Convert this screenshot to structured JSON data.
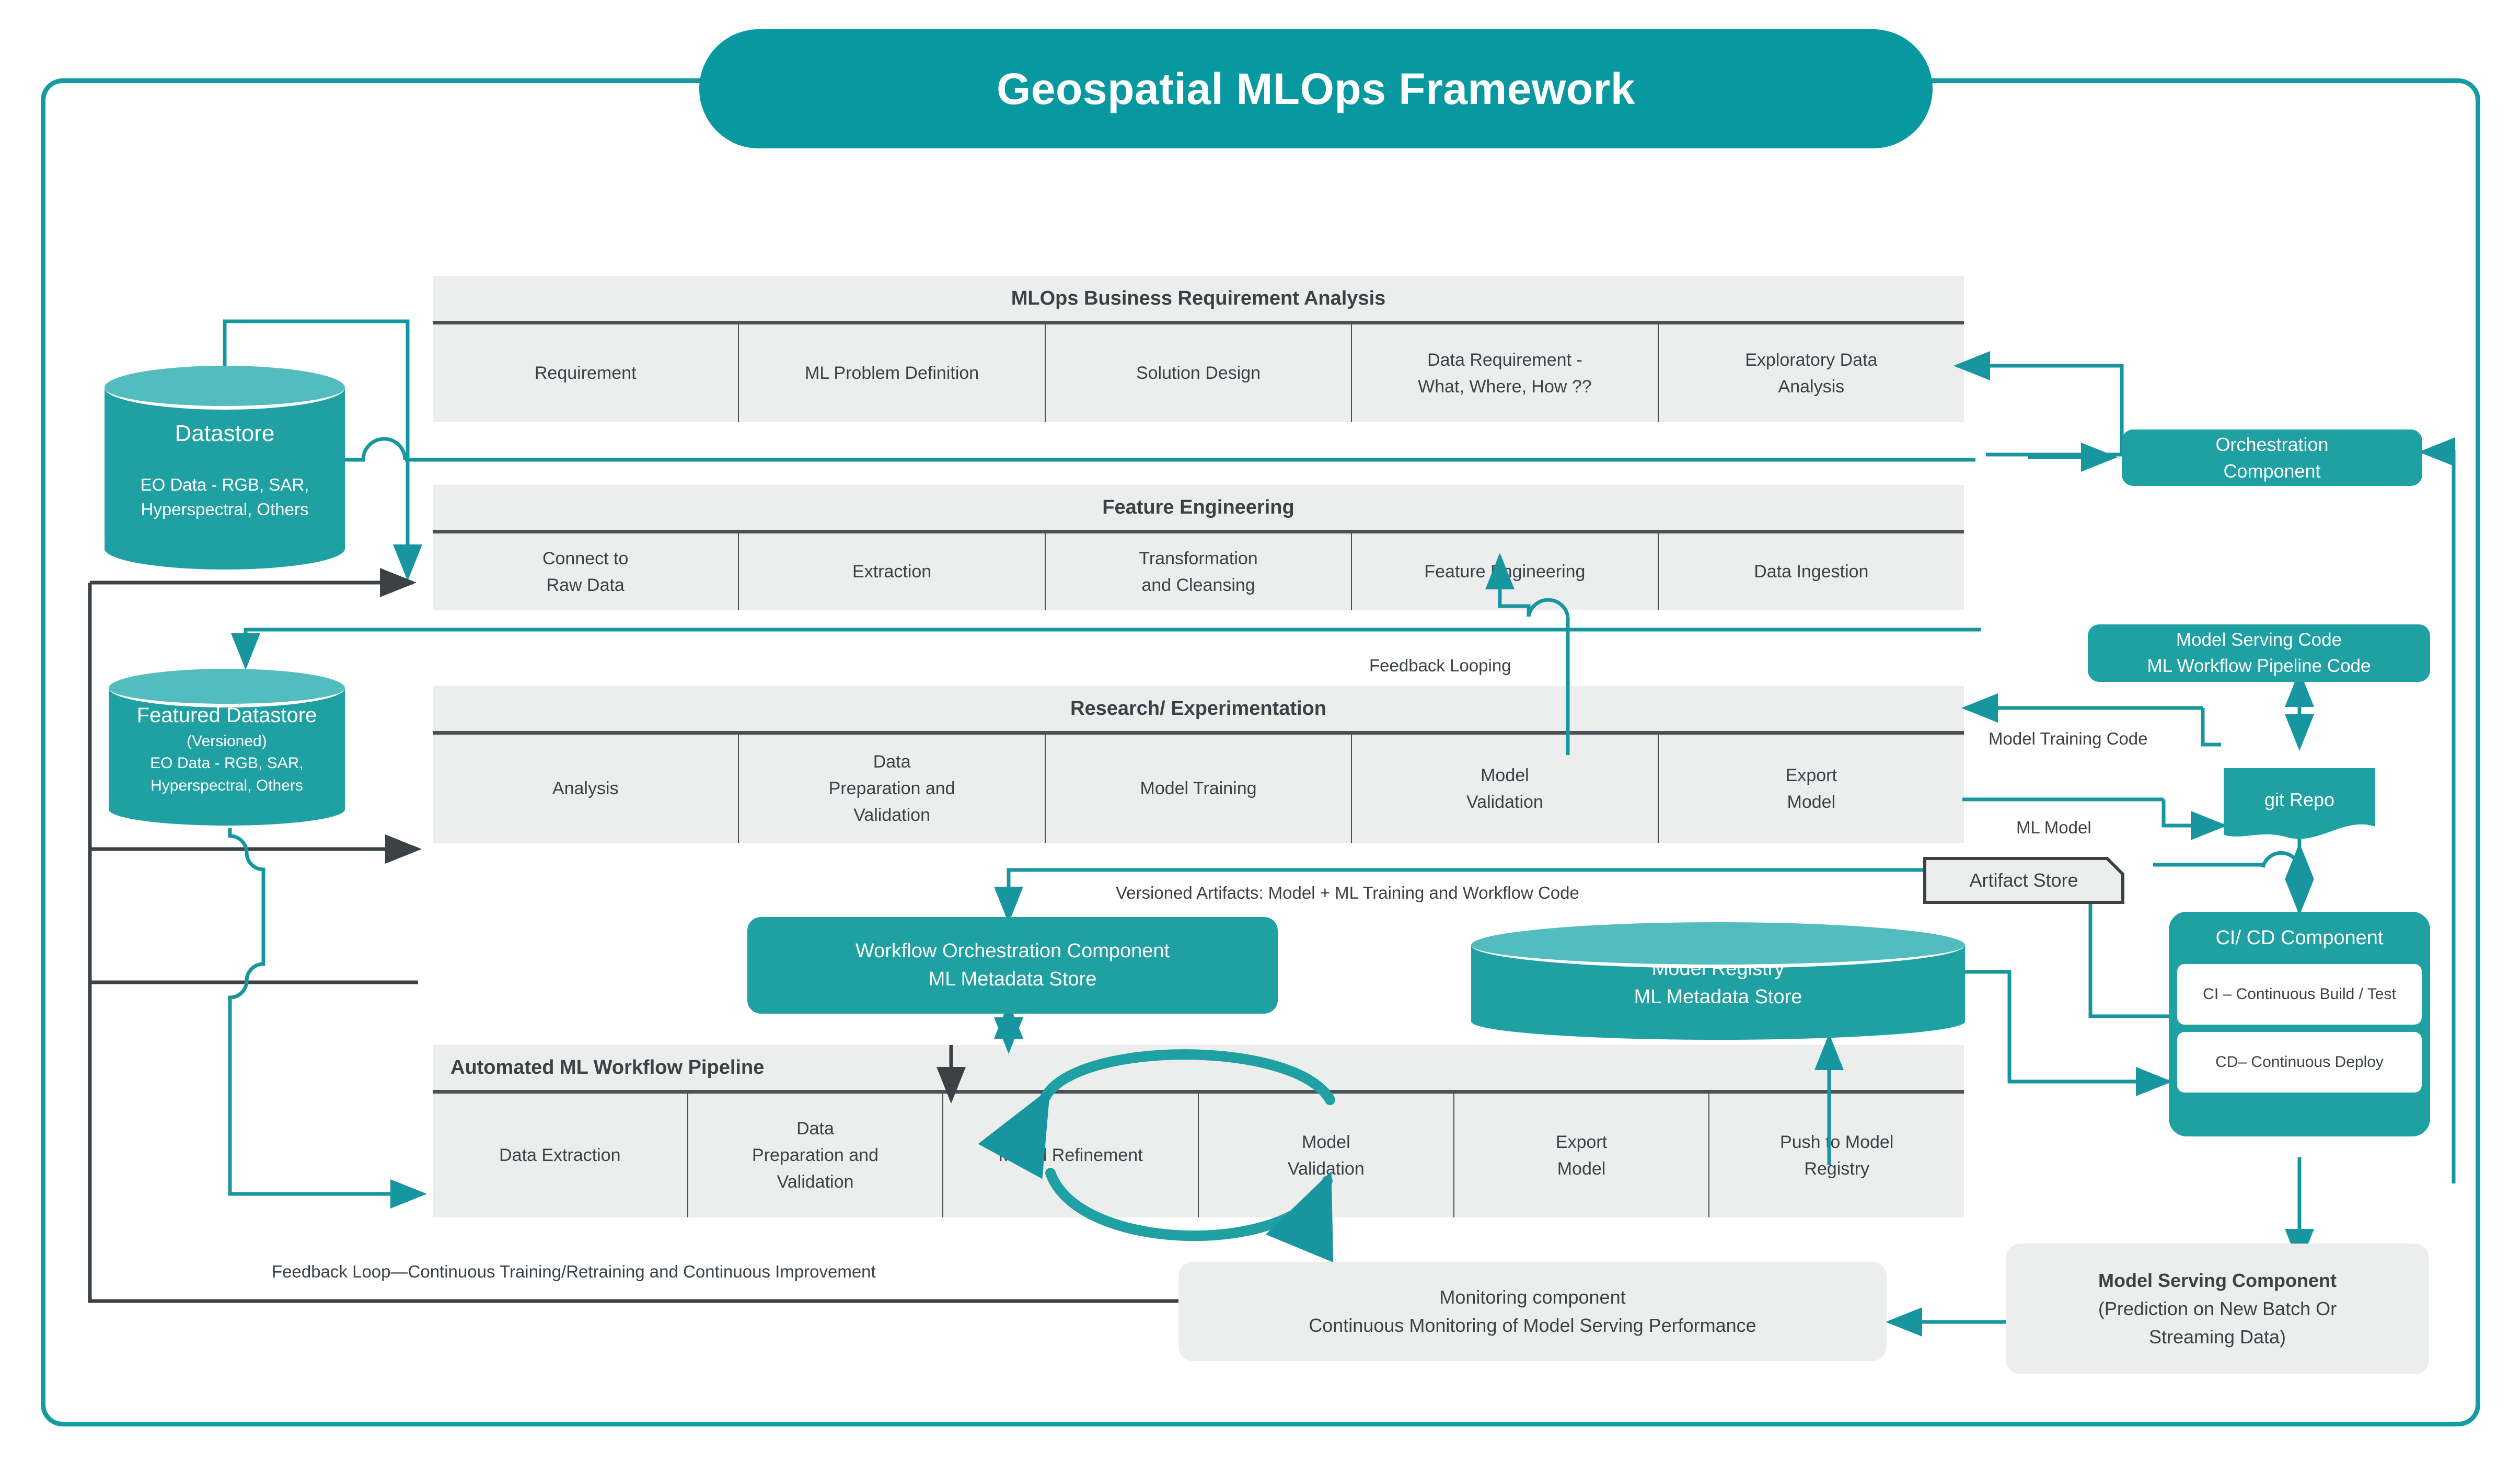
{
  "header": {
    "title": "Geospatial MLOps Framework"
  },
  "colors": {
    "teal": "#1FA0A3",
    "teal_header": "#0898A0",
    "teal_light": "#53BCBE",
    "gray_panel": "#ECEDED",
    "dark_rule": "#4A5258",
    "text_dark": "#3A4247"
  },
  "datastore": {
    "title": "Datastore",
    "line1": "EO Data - RGB, SAR,",
    "line2": "Hyperspectral, Others"
  },
  "featured_datastore": {
    "title": "Featured Datastore",
    "line1": "(Versioned)",
    "line2": "EO Data - RGB, SAR,",
    "line3": "Hyperspectral, Others"
  },
  "tables": [
    {
      "id": "business-requirement-analysis",
      "title": "MLOps Business Requirement Analysis",
      "title_align": "center",
      "cells": [
        "Requirement",
        "ML Problem Definition",
        "Solution Design",
        "Data Requirement -\nWhat, Where, How ??",
        "Exploratory Data\nAnalysis"
      ]
    },
    {
      "id": "feature-engineering",
      "title": "Feature Engineering",
      "title_align": "center",
      "cells": [
        "Connect to\nRaw Data",
        "Extraction",
        "Transformation\nand Cleansing",
        "Feature Engineering",
        "Data Ingestion"
      ]
    },
    {
      "id": "research-experimentation",
      "title": "Research/ Experimentation",
      "title_align": "center",
      "cells": [
        "Analysis",
        "Data\nPreparation and\nValidation",
        "Model Training",
        "Model\nValidation",
        "Export\nModel"
      ]
    },
    {
      "id": "automated-ml-workflow-pipeline",
      "title": "Automated ML Workflow Pipeline",
      "title_align": "left",
      "cells": [
        "Data Extraction",
        "Data\nPreparation and\nValidation",
        "Model Refinement",
        "Model\nValidation",
        "Export\nModel",
        "Push to Model\nRegistry"
      ]
    }
  ],
  "boxes": {
    "orchestration_component": {
      "line1": "Orchestration",
      "line2": "Component"
    },
    "model_serving_code": {
      "line1": "Model Serving Code",
      "line2": "ML Workflow Pipeline Code"
    },
    "git_repo": {
      "label": "git Repo"
    },
    "cicd_component": {
      "title": "CI/ CD Component",
      "ci": "CI – Continuous Build / Test",
      "cd": "CD– Continuous Deploy"
    },
    "workflow_orchestration": {
      "line1": "Workflow Orchestration Component",
      "line2": "ML Metadata Store"
    },
    "model_registry": {
      "line1": "Model Registry",
      "line2": "ML Metadata Store"
    },
    "artifact_store": {
      "label": "Artifact Store"
    },
    "monitoring_component": {
      "line1": "Monitoring component",
      "line2": "Continuous Monitoring of Model Serving Performance"
    },
    "model_serving_component": {
      "line1": "Model Serving Component",
      "line2": "(Prediction on New Batch Or",
      "line3": "Streaming Data)"
    }
  },
  "edge_labels": {
    "feedback_looping": "Feedback Looping",
    "versioned_artifacts": "Versioned Artifacts: Model + ML Training and Workflow Code",
    "model_training_code": "Model Training Code",
    "ml_model": "ML Model",
    "feedback_loop_bottom": "Feedback Loop—Continuous Training/Retraining and Continuous Improvement"
  }
}
